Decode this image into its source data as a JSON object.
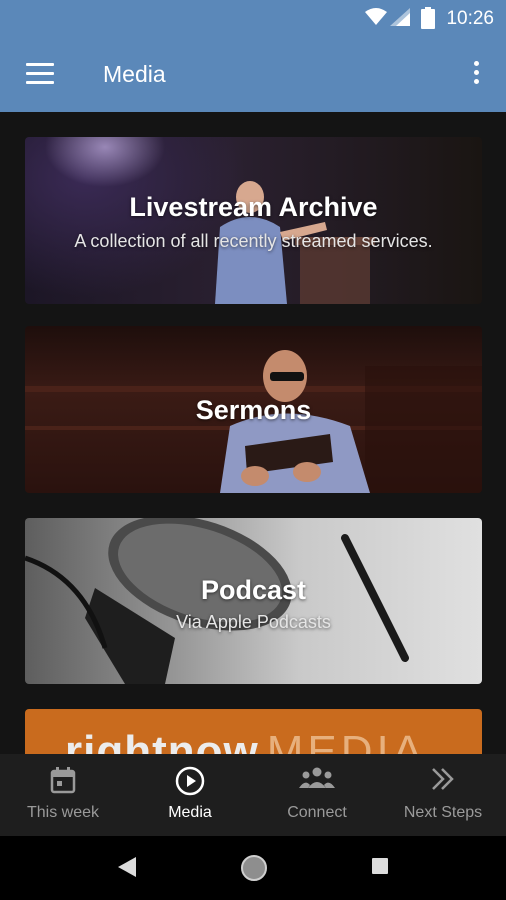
{
  "status_bar": {
    "time": "10:26"
  },
  "app_bar": {
    "title": "Media"
  },
  "cards": [
    {
      "title": "Livestream Archive",
      "subtitle": "A collection of all recently streamed services."
    },
    {
      "title": "Sermons"
    },
    {
      "title": "Podcast",
      "subtitle": "Via Apple Podcasts"
    },
    {
      "logo_bold": "rightnow",
      "logo_light": "MEDIA"
    }
  ],
  "bottom_nav": [
    {
      "label": "This week",
      "icon": "calendar-icon",
      "active": false
    },
    {
      "label": "Media",
      "icon": "play-circle-icon",
      "active": true
    },
    {
      "label": "Connect",
      "icon": "people-icon",
      "active": false
    },
    {
      "label": "Next Steps",
      "icon": "double-chevron-right-icon",
      "active": false
    }
  ],
  "colors": {
    "app_bar": "#5b88b9",
    "background": "#141414",
    "bottom_nav": "#1e1e1e",
    "rightnow_orange": "#c96b1e"
  }
}
